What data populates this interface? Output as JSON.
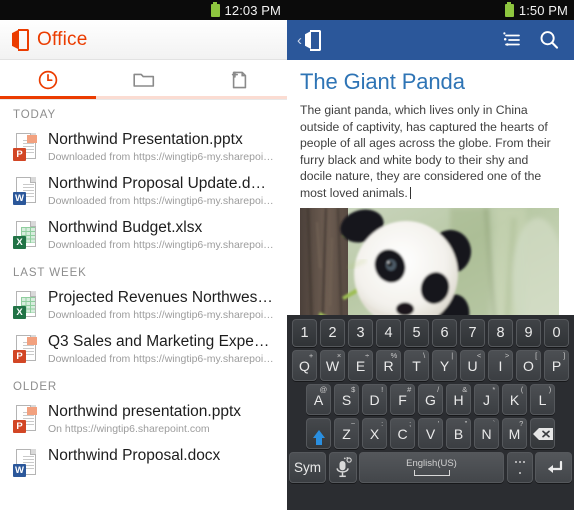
{
  "left": {
    "statusbar": {
      "time": "12:03 PM",
      "battery_icon": "battery-icon"
    },
    "header": {
      "app_title": "Office",
      "logo_icon": "office-logo-icon"
    },
    "tabs": [
      {
        "name": "recent",
        "icon": "clock-icon",
        "active": true
      },
      {
        "name": "open",
        "icon": "folder-icon",
        "active": false
      },
      {
        "name": "new",
        "icon": "new-document-icon",
        "active": false
      }
    ],
    "groups": [
      {
        "header": "TODAY",
        "files": [
          {
            "title": "Northwind Presentation.pptx",
            "subtitle": "Downloaded from https://wingtip6-my.sharepoint...",
            "kind": "ppt",
            "badge": "P"
          },
          {
            "title": "Northwind Proposal Update.d…",
            "subtitle": "Downloaded from https://wingtip6-my.sharepoint...",
            "kind": "doc",
            "badge": "W"
          },
          {
            "title": "Northwind Budget.xlsx",
            "subtitle": "Downloaded from https://wingtip6-my.sharepoint...",
            "kind": "xls",
            "badge": "X"
          }
        ]
      },
      {
        "header": "LAST WEEK",
        "files": [
          {
            "title": "Projected Revenues Northwes…",
            "subtitle": "Downloaded from https://wingtip6-my.sharepoint...",
            "kind": "xls",
            "badge": "X"
          },
          {
            "title": "Q3 Sales and Marketing Expe…",
            "subtitle": "Downloaded from https://wingtip6-my.sharepoint...",
            "kind": "ppt",
            "badge": "P"
          }
        ]
      },
      {
        "header": "OLDER",
        "files": [
          {
            "title": "Northwind presentation.pptx",
            "subtitle": "On https://wingtip6.sharepoint.com",
            "kind": "ppt",
            "badge": "P"
          },
          {
            "title": "Northwind Proposal.docx",
            "subtitle": "",
            "kind": "doc",
            "badge": "W"
          }
        ]
      }
    ]
  },
  "right": {
    "statusbar": {
      "time": "1:50 PM",
      "battery_icon": "battery-icon"
    },
    "header": {
      "back_icon": "back-chevron-icon",
      "logo_icon": "office-logo-icon",
      "outline_icon": "outline-view-icon",
      "search_icon": "search-icon"
    },
    "document": {
      "title": "The Giant Panda",
      "body": "The giant panda, which lives only in China outside of captivity, has captured the hearts of people of all ages across the globe. From their furry black and white body to their shy and docile nature, they are considered one of the most loved animals.",
      "image_alt": "giant-panda-photo"
    },
    "keyboard": {
      "numbers": [
        "1",
        "2",
        "3",
        "4",
        "5",
        "6",
        "7",
        "8",
        "9",
        "0"
      ],
      "row1": [
        {
          "key": "Q",
          "sup": "+"
        },
        {
          "key": "W",
          "sup": "×"
        },
        {
          "key": "E",
          "sup": "÷"
        },
        {
          "key": "R",
          "sup": "%"
        },
        {
          "key": "T",
          "sup": "\\"
        },
        {
          "key": "Y",
          "sup": "|"
        },
        {
          "key": "U",
          "sup": "<"
        },
        {
          "key": "I",
          "sup": ">"
        },
        {
          "key": "O",
          "sup": "["
        },
        {
          "key": "P",
          "sup": "]"
        }
      ],
      "row2": [
        {
          "key": "A",
          "sup": "@"
        },
        {
          "key": "S",
          "sup": "$"
        },
        {
          "key": "D",
          "sup": "!"
        },
        {
          "key": "F",
          "sup": "#"
        },
        {
          "key": "G",
          "sup": "/"
        },
        {
          "key": "H",
          "sup": "&"
        },
        {
          "key": "J",
          "sup": "*"
        },
        {
          "key": "K",
          "sup": "("
        },
        {
          "key": "L",
          "sup": ")"
        }
      ],
      "row3": [
        {
          "key": "Z",
          "sup": "~"
        },
        {
          "key": "X",
          "sup": ":"
        },
        {
          "key": "C",
          "sup": ";"
        },
        {
          "key": "V",
          "sup": "'"
        },
        {
          "key": "B",
          "sup": "\""
        },
        {
          "key": "N",
          "sup": "`"
        },
        {
          "key": "M",
          "sup": "?"
        }
      ],
      "shift_icon": "shift-arrow-icon",
      "backspace_icon": "backspace-icon",
      "sym_label": "Sym",
      "mic_icon": "microphone-settings-icon",
      "space_label": "English(US)",
      "dot_icon": "punctuation-key-icon",
      "enter_icon": "enter-key-icon"
    }
  },
  "colors": {
    "office_orange": "#eb3c00",
    "word_blue": "#2b579a",
    "doc_title_blue": "#2e74b5",
    "battery_green": "#8ec63f",
    "shift_blue": "#2a8fe0",
    "keyboard_bg": "#2b2d31"
  }
}
